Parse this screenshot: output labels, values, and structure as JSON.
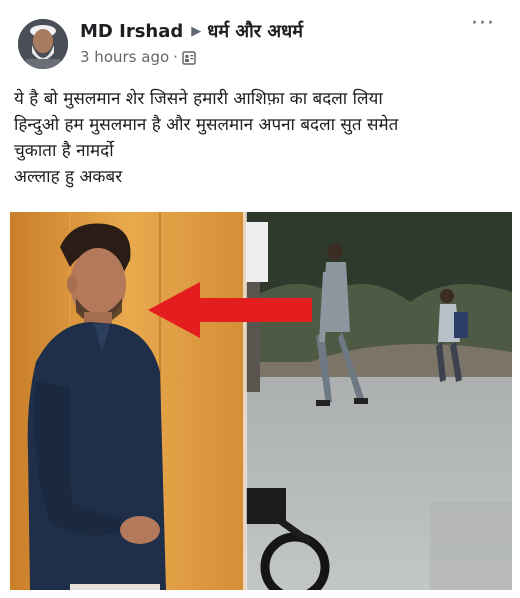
{
  "post": {
    "author": "MD Irshad",
    "group": "धर्म और अधर्म",
    "timestamp": "3 hours ago",
    "separator": "·",
    "privacy_icon": "friends-icon",
    "more_label": "···",
    "text_lines": [
      "ये है बो मुसलमान शेर जिसने हमारी आशिफ़ा का बदला लिया",
      "हिन्दुओ हम मुसलमान है और मुसलमान अपना बदला सुत समेत",
      "चुकाता है नामर्दो",
      "अल्लाह हु अकबर"
    ],
    "image": {
      "arrow_color": "#e41e1e",
      "description_icon": "comparison-photo"
    }
  }
}
